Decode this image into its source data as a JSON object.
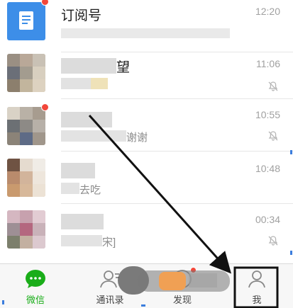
{
  "chats": [
    {
      "name": "订阅号",
      "preview": "",
      "time": "12:20",
      "muted": false,
      "avatar": "subscription-icon",
      "unread_dot": true
    },
    {
      "name": "望",
      "preview": "",
      "time": "11:06",
      "muted": true,
      "avatar": "photo",
      "unread_dot": false
    },
    {
      "name": "",
      "preview": "谢谢",
      "time": "10:55",
      "muted": true,
      "avatar": "photo",
      "unread_dot": true
    },
    {
      "name": "",
      "preview": "去吃",
      "time": "10:48",
      "muted": false,
      "avatar": "photo",
      "unread_dot": false
    },
    {
      "name": "",
      "preview": "宋]",
      "time": "00:34",
      "muted": true,
      "avatar": "photo",
      "unread_dot": false
    }
  ],
  "tabs": [
    {
      "label": "微信",
      "icon": "chat-bubble-icon",
      "active": true
    },
    {
      "label": "通讯录",
      "icon": "contacts-icon",
      "active": false
    },
    {
      "label": "发现",
      "icon": "compass-icon",
      "active": false
    },
    {
      "label": "我",
      "icon": "person-icon",
      "active": false
    }
  ],
  "colors": {
    "accent": "#1aad19",
    "unread": "#f2473a",
    "subscription_bg": "#3d8ee8",
    "annotation": "#111111"
  }
}
